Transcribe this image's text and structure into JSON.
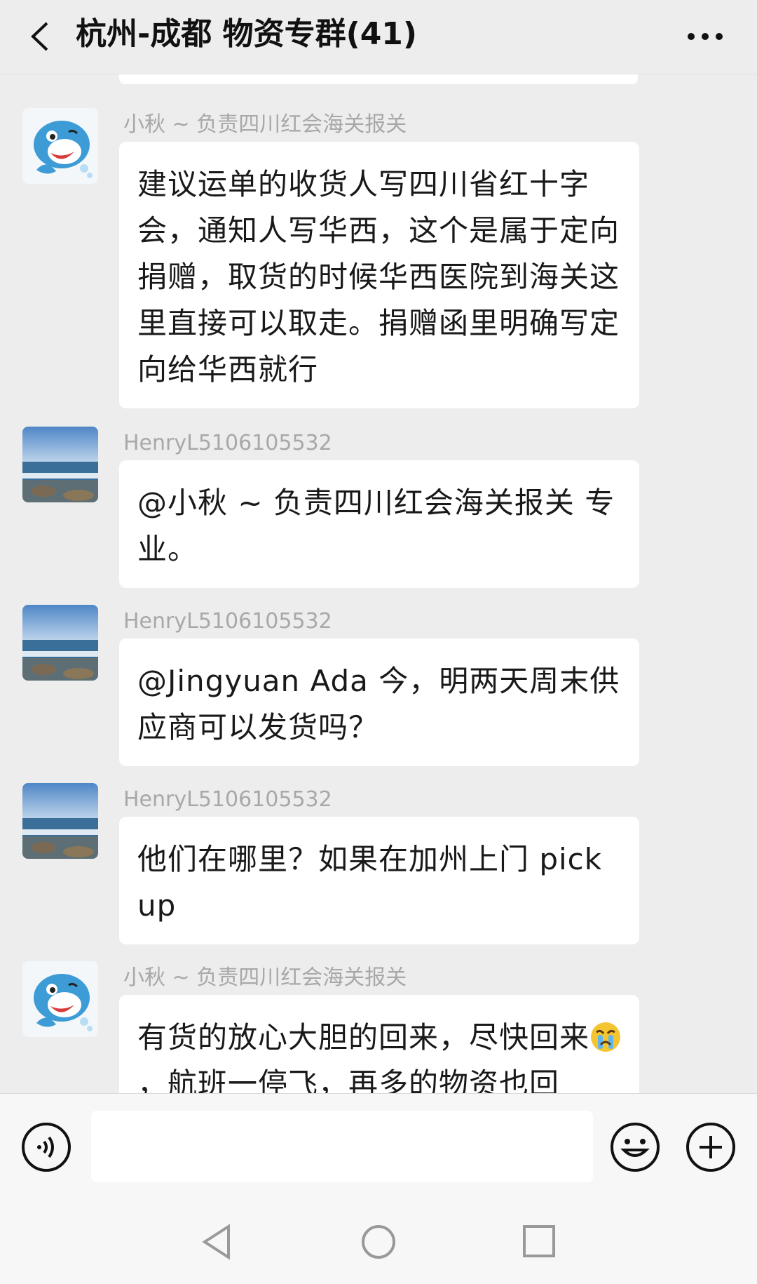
{
  "header": {
    "title": "杭州-成都 物资专群(41)",
    "back_icon": "chevron-left-icon",
    "more_icon": "more-dots-icon"
  },
  "messages": [
    {
      "sender": "小秋 ~ 负责四川红会海关报关",
      "avatar": "dolphin-avatar",
      "text": "建议运单的收货人写四川省红十字会，通知人写华西，这个是属于定向捐赠，取货的时候华西医院到海关这里直接可以取走。捐赠函里明确写定向给华西就行"
    },
    {
      "sender": "HenryL5106105532",
      "avatar": "seascape-avatar",
      "text": "@小秋 ~ 负责四川红会海关报关  专业。"
    },
    {
      "sender": "HenryL5106105532",
      "avatar": "seascape-avatar",
      "text": "@Jingyuan Ada  今，明两天周末供应商可以发货吗？"
    },
    {
      "sender": "HenryL5106105532",
      "avatar": "seascape-avatar",
      "text": "他们在哪里？如果在加州上门 pick up"
    },
    {
      "sender": "小秋 ~ 负责四川红会海关报关",
      "avatar": "dolphin-avatar",
      "text_part1": "有货的放心大胆的回来，尽快回来",
      "text_emoji": "crying-face-emoji",
      "text_part2": "，航班一停飞，再多的物资也回"
    }
  ],
  "input_bar": {
    "voice_icon": "voice-icon",
    "emoji_icon": "smiley-icon",
    "plus_icon": "plus-circle-icon",
    "input_value": ""
  },
  "navbar": {
    "back_icon": "nav-back-triangle-icon",
    "home_icon": "nav-home-circle-icon",
    "recent_icon": "nav-recent-square-icon"
  },
  "colors": {
    "background": "#ededed",
    "bubble": "#ffffff",
    "sender_name": "#a8a8a8",
    "text": "#191919"
  }
}
